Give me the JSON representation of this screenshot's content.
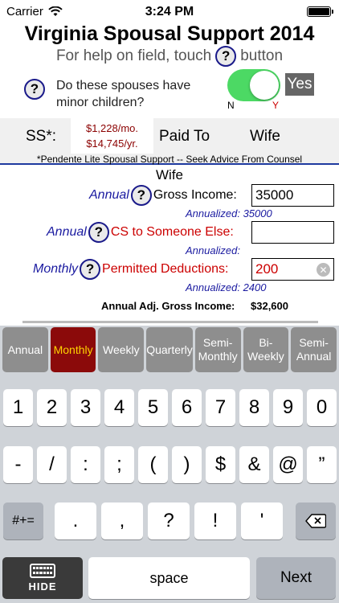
{
  "status_bar": {
    "carrier": "Carrier",
    "time": "3:24 PM"
  },
  "app": {
    "title": "Virginia Spousal Support 2014",
    "help_prefix": "For help on field, touch",
    "help_suffix": "button",
    "help_symbol": "?"
  },
  "minor_children": {
    "question": "Do these spouses have minor children?",
    "value": "Yes",
    "n_label": "N",
    "y_label": "Y",
    "on": true
  },
  "support": {
    "label": "SS*:",
    "monthly": "$1,228/mo.",
    "yearly": "$14,745/yr.",
    "paid_to_label": "Paid To",
    "paid_to": "Wife",
    "footnote": "*Pendente Lite Spousal Support -- Seek Advice From Counsel"
  },
  "section": {
    "title": "Wife"
  },
  "fields": [
    {
      "freq": "Annual",
      "label": "Gross Income:",
      "value": "35000",
      "annualized_label": "Annualized:",
      "annualized_value": "35000",
      "red": false
    },
    {
      "freq": "Annual",
      "label": "CS to Someone Else:",
      "value": "",
      "annualized_label": "Annualized:",
      "annualized_value": "",
      "red": true
    },
    {
      "freq": "Monthly",
      "label": "Permitted Deductions:",
      "value": "200",
      "annualized_label": "Annualized:",
      "annualized_value": "2400",
      "red": true
    }
  ],
  "adjusted": {
    "label": "Annual Adj. Gross Income:",
    "value": "$32,600"
  },
  "frequency_bar": [
    {
      "label": "Annual",
      "active": false
    },
    {
      "label": "Monthly",
      "active": true
    },
    {
      "label": "Weekly",
      "active": false
    },
    {
      "label": "Quarterly",
      "active": false
    },
    {
      "label": "Semi-\nMonthly",
      "active": false
    },
    {
      "label": "Bi-\nWeekly",
      "active": false
    },
    {
      "label": "Semi-\nAnnual",
      "active": false
    }
  ],
  "keyboard": {
    "row1": [
      "1",
      "2",
      "3",
      "4",
      "5",
      "6",
      "7",
      "8",
      "9",
      "0"
    ],
    "row2": [
      "-",
      "/",
      ":",
      ";",
      "(",
      ")",
      "$",
      "&",
      "@",
      "”"
    ],
    "row3_left": "#+=",
    "row3": [
      ".",
      ",",
      "?",
      "!",
      "'"
    ],
    "hide_label": "HIDE",
    "space_label": "space",
    "next_label": "Next"
  },
  "icons": {
    "wifi": "wifi-icon",
    "battery": "battery-icon",
    "help": "help-icon",
    "clear": "clear-icon",
    "backspace": "backspace-icon",
    "keyboard": "keyboard-icon"
  },
  "colors": {
    "toggle_on": "#4cd964",
    "active_freq_bg": "#8b0a0a",
    "active_freq_text": "#ffd200",
    "label_blue": "#1a1aa0",
    "label_red": "#cc0000",
    "amount_red": "#8b0000"
  }
}
